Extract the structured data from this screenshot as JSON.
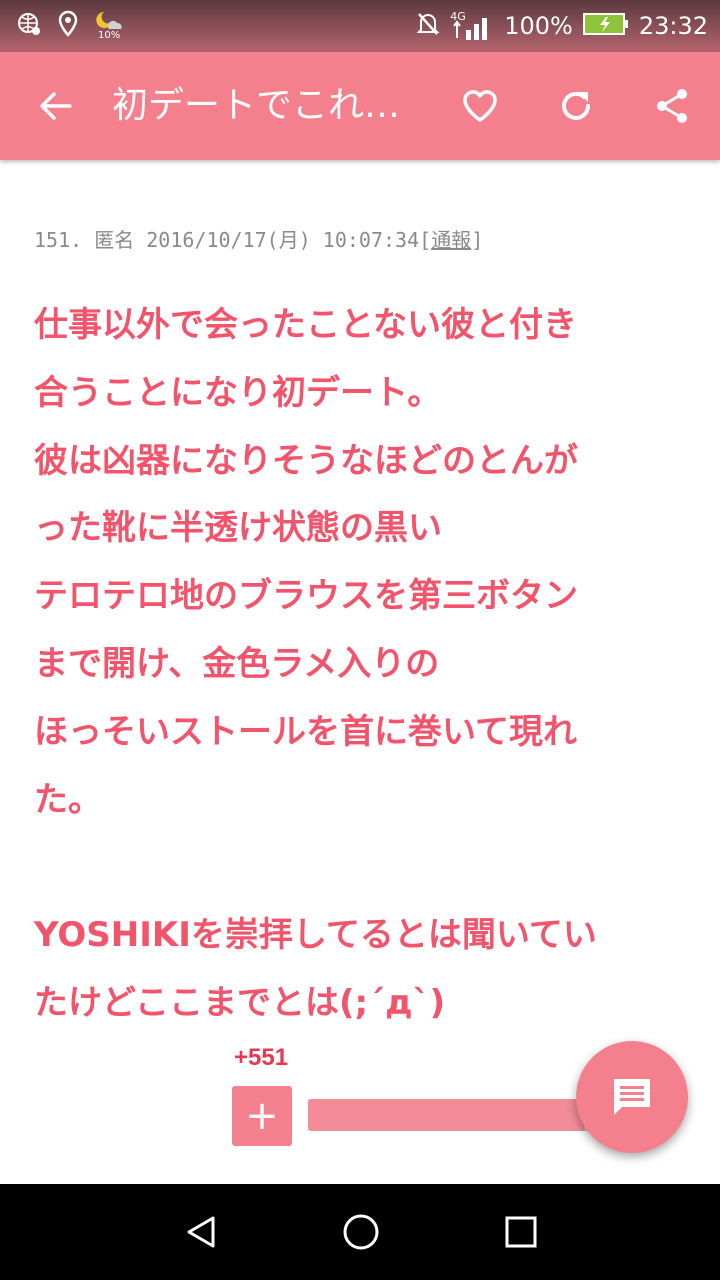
{
  "status_bar": {
    "icons": [
      "globe-icon",
      "location-icon",
      "weather-icon",
      "mute-icon",
      "signal-icon",
      "battery-icon"
    ],
    "weather_temp": "10%",
    "network": "4G",
    "battery": "100%",
    "time": "23:32",
    "battery_color": "#8fc43a"
  },
  "app_bar": {
    "title": "初デートでこれ…",
    "background": "#f4808d",
    "icons": [
      "back-arrow-icon",
      "heart-icon",
      "refresh-icon",
      "share-icon"
    ]
  },
  "post": {
    "number": "151.",
    "author": "匿名",
    "datetime": "2016/10/17(月) 10:07:34",
    "report_open": "[",
    "report_label": "通報",
    "report_close": "]",
    "text_color": "#f1546b",
    "body_lines": [
      "仕事以外で会ったことない彼と付き",
      "合うことになり初デート。",
      "彼は凶器になりそうなほどのとんが",
      "った靴に半透け状態の黒い",
      "テロテロ地のブラウスを第三ボタン",
      "まで開け、金色ラメ入りの",
      "ほっそいストールを首に巻いて現れ",
      "た。",
      "",
      "YOSHIKIを崇拝してるとは聞いてい",
      "たけどここまでとは(;´д`)"
    ]
  },
  "vote": {
    "count": "+551",
    "plus_label": "+",
    "ratio": 0.77
  },
  "fab": {
    "icon": "comment-icon"
  },
  "nav_bar": {
    "icons": [
      "back-triangle-icon",
      "home-circle-icon",
      "recents-square-icon"
    ]
  }
}
